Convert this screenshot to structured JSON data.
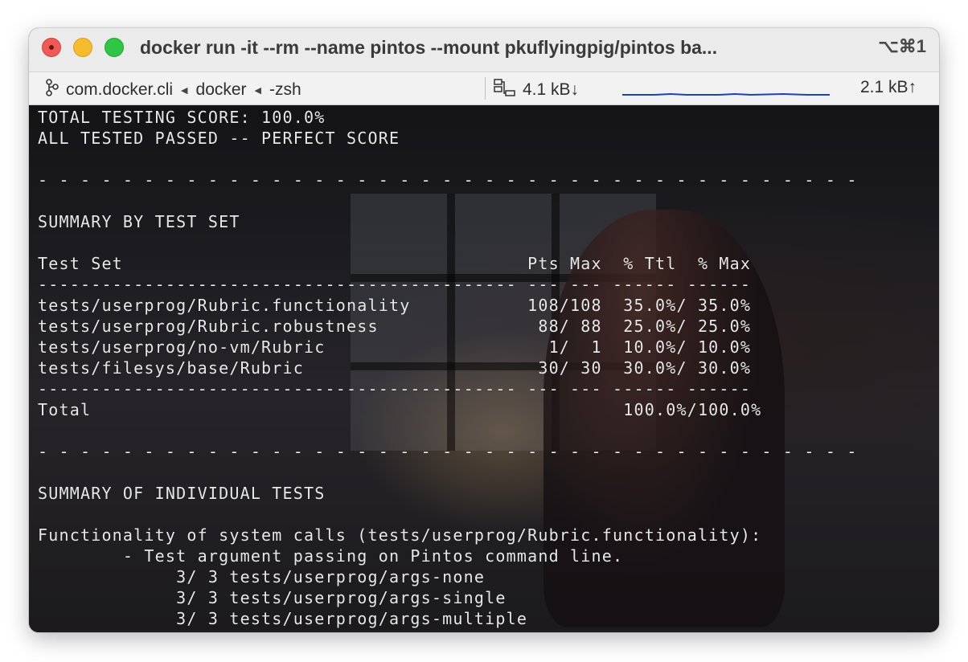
{
  "window": {
    "title": "docker run -it --rm --name pintos --mount  pkuflyingpig/pintos ba...",
    "shortcut": "⌥⌘1"
  },
  "tabbar": {
    "branch_icon": "branch-icon",
    "crumbs": [
      "com.docker.cli",
      "docker",
      "-zsh"
    ],
    "network_icon": "network-icon",
    "download": "4.1 kB↓",
    "upload": "2.1 kB↑"
  },
  "colors": {
    "close": "#ee5a55",
    "minimize": "#f5bc2d",
    "maximize": "#2fc545",
    "sparkline": "#1f3fbf"
  },
  "terminal": {
    "lines": [
      "TOTAL TESTING SCORE: 100.0%",
      "ALL TESTED PASSED -- PERFECT SCORE",
      "",
      "- - - - - - - - - - - - - - - - - - - - - - - - - - - - - - - - - - - - - - -",
      "",
      "SUMMARY BY TEST SET",
      "",
      "Test Set                                      Pts Max  % Ttl  % Max",
      "--------------------------------------------- --- --- ------ ------",
      "tests/userprog/Rubric.functionality           108/108  35.0%/ 35.0%",
      "tests/userprog/Rubric.robustness               88/ 88  25.0%/ 25.0%",
      "tests/userprog/no-vm/Rubric                     1/  1  10.0%/ 10.0%",
      "tests/filesys/base/Rubric                      30/ 30  30.0%/ 30.0%",
      "--------------------------------------------- --- --- ------ ------",
      "Total                                                  100.0%/100.0%",
      "",
      "- - - - - - - - - - - - - - - - - - - - - - - - - - - - - - - - - - - - - - -",
      "",
      "SUMMARY OF INDIVIDUAL TESTS",
      "",
      "Functionality of system calls (tests/userprog/Rubric.functionality):",
      "        - Test argument passing on Pintos command line.",
      "             3/ 3 tests/userprog/args-none",
      "             3/ 3 tests/userprog/args-single",
      "             3/ 3 tests/userprog/args-multiple"
    ]
  }
}
